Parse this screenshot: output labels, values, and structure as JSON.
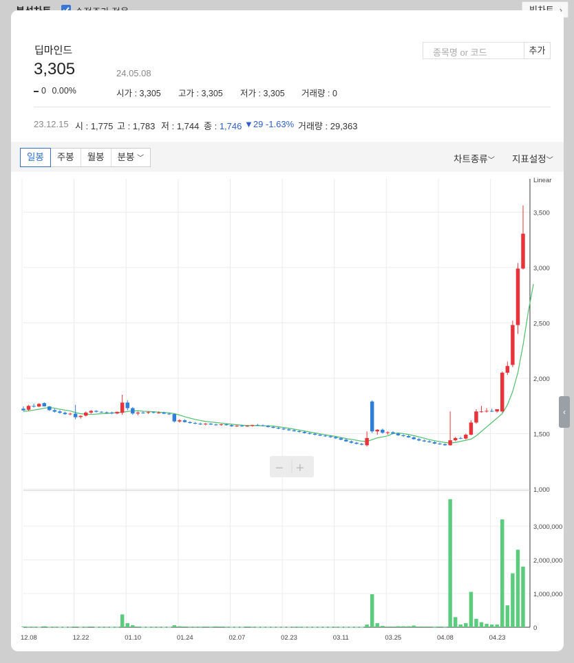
{
  "header": {
    "title": "분석차트",
    "adjusted_label": "수정주가 적용",
    "adjusted_checked": true,
    "big_chart": "빅차트"
  },
  "stock": {
    "name": "딥마인드",
    "price": "3,305",
    "date": "24.05.08",
    "change": "0",
    "change_pct": "0.00%",
    "open_label": "시가",
    "open": "3,305",
    "high_label": "고가",
    "high": "3,305",
    "low_label": "저가",
    "low": "3,305",
    "volume_label": "거래량",
    "volume": "0"
  },
  "search": {
    "placeholder": "종목명 or 코드",
    "add": "추가"
  },
  "hover": {
    "date": "23.12.15",
    "open_label": "시",
    "open": "1,775",
    "high_label": "고",
    "high": "1,783",
    "low_label": "저",
    "low": "1,744",
    "close_label": "종",
    "close": "1,746",
    "diff": "▼29",
    "diff_pct": "-1.63%",
    "volume_label": "거래량",
    "volume": "29,363"
  },
  "tabs": [
    {
      "label": "일봉",
      "active": true
    },
    {
      "label": "주봉"
    },
    {
      "label": "월봉"
    },
    {
      "label": "분봉"
    }
  ],
  "menus": {
    "chart_type": "차트종류",
    "indicator": "지표설정"
  },
  "zoom": {
    "minus": "−",
    "plus": "+"
  },
  "colors": {
    "up": "#e8333a",
    "down": "#2f7fd6",
    "volume": "#5bcc7e",
    "ma5": "#4fbf6c",
    "ma20": "#d04b3a",
    "ma60": "#e89a3c",
    "ma120": "#b66bd6"
  },
  "chart_data": {
    "type": "candlestick",
    "scale_label": "Linear",
    "price_ticks": [
      "3,500",
      "3,000",
      "2,500",
      "2,000",
      "1,500",
      "1,000"
    ],
    "price_tick_values": [
      3500,
      3000,
      2500,
      2000,
      1500,
      1000
    ],
    "ylim": [
      1000,
      3800
    ],
    "volume_ticks": [
      "3,000,000",
      "2,000,000",
      "1,000,000",
      "0"
    ],
    "volume_tick_values": [
      3000000,
      2000000,
      1000000,
      0
    ],
    "vlim": [
      0,
      4000000
    ],
    "x_tick_labels": [
      "12.08",
      "12.22",
      "01.10",
      "01.24",
      "02.07",
      "02.23",
      "03.11",
      "03.25",
      "04.08",
      "04.23"
    ],
    "x_tick_index": [
      0,
      10,
      20,
      30,
      40,
      50,
      60,
      70,
      80,
      90
    ],
    "candles": [
      {
        "o": 1725,
        "h": 1745,
        "l": 1705,
        "c": 1710,
        "v": 20000
      },
      {
        "o": 1715,
        "h": 1760,
        "l": 1705,
        "c": 1750,
        "v": 15000
      },
      {
        "o": 1750,
        "h": 1770,
        "l": 1735,
        "c": 1745,
        "v": 15000
      },
      {
        "o": 1745,
        "h": 1775,
        "l": 1738,
        "c": 1768,
        "v": 10000
      },
      {
        "o": 1775,
        "h": 1783,
        "l": 1744,
        "c": 1746,
        "v": 29363
      },
      {
        "o": 1745,
        "h": 1750,
        "l": 1705,
        "c": 1712,
        "v": 12000
      },
      {
        "o": 1712,
        "h": 1725,
        "l": 1690,
        "c": 1698,
        "v": 15000
      },
      {
        "o": 1700,
        "h": 1712,
        "l": 1680,
        "c": 1688,
        "v": 10000
      },
      {
        "o": 1688,
        "h": 1698,
        "l": 1670,
        "c": 1676,
        "v": 10000
      },
      {
        "o": 1676,
        "h": 1690,
        "l": 1665,
        "c": 1680,
        "v": 8000
      },
      {
        "o": 1680,
        "h": 1760,
        "l": 1630,
        "c": 1648,
        "v": 20000
      },
      {
        "o": 1650,
        "h": 1665,
        "l": 1635,
        "c": 1660,
        "v": 10000
      },
      {
        "o": 1662,
        "h": 1700,
        "l": 1655,
        "c": 1690,
        "v": 15000
      },
      {
        "o": 1690,
        "h": 1712,
        "l": 1680,
        "c": 1705,
        "v": 20000
      },
      {
        "o": 1705,
        "h": 1712,
        "l": 1690,
        "c": 1697,
        "v": 10000
      },
      {
        "o": 1697,
        "h": 1702,
        "l": 1688,
        "c": 1692,
        "v": 8000
      },
      {
        "o": 1692,
        "h": 1700,
        "l": 1682,
        "c": 1690,
        "v": 8000
      },
      {
        "o": 1690,
        "h": 1698,
        "l": 1675,
        "c": 1682,
        "v": 10000
      },
      {
        "o": 1682,
        "h": 1700,
        "l": 1675,
        "c": 1696,
        "v": 12000
      },
      {
        "o": 1688,
        "h": 1850,
        "l": 1670,
        "c": 1780,
        "v": 380000
      },
      {
        "o": 1780,
        "h": 1800,
        "l": 1710,
        "c": 1730,
        "v": 120000
      },
      {
        "o": 1730,
        "h": 1740,
        "l": 1670,
        "c": 1682,
        "v": 60000
      },
      {
        "o": 1682,
        "h": 1700,
        "l": 1665,
        "c": 1690,
        "v": 20000
      },
      {
        "o": 1690,
        "h": 1705,
        "l": 1680,
        "c": 1687,
        "v": 10000
      },
      {
        "o": 1687,
        "h": 1700,
        "l": 1678,
        "c": 1694,
        "v": 10000
      },
      {
        "o": 1694,
        "h": 1700,
        "l": 1682,
        "c": 1688,
        "v": 8000
      },
      {
        "o": 1688,
        "h": 1700,
        "l": 1680,
        "c": 1690,
        "v": 8000
      },
      {
        "o": 1690,
        "h": 1698,
        "l": 1675,
        "c": 1680,
        "v": 10000
      },
      {
        "o": 1680,
        "h": 1690,
        "l": 1668,
        "c": 1676,
        "v": 10000
      },
      {
        "o": 1676,
        "h": 1682,
        "l": 1600,
        "c": 1610,
        "v": 60000
      },
      {
        "o": 1610,
        "h": 1630,
        "l": 1598,
        "c": 1620,
        "v": 30000
      },
      {
        "o": 1620,
        "h": 1630,
        "l": 1600,
        "c": 1604,
        "v": 20000
      },
      {
        "o": 1604,
        "h": 1612,
        "l": 1590,
        "c": 1596,
        "v": 15000
      },
      {
        "o": 1596,
        "h": 1605,
        "l": 1585,
        "c": 1590,
        "v": 15000
      },
      {
        "o": 1590,
        "h": 1600,
        "l": 1578,
        "c": 1585,
        "v": 15000
      },
      {
        "o": 1585,
        "h": 1595,
        "l": 1575,
        "c": 1590,
        "v": 20000
      },
      {
        "o": 1590,
        "h": 1595,
        "l": 1578,
        "c": 1582,
        "v": 15000
      },
      {
        "o": 1582,
        "h": 1590,
        "l": 1572,
        "c": 1578,
        "v": 25000
      },
      {
        "o": 1578,
        "h": 1588,
        "l": 1570,
        "c": 1584,
        "v": 20000
      },
      {
        "o": 1584,
        "h": 1590,
        "l": 1572,
        "c": 1576,
        "v": 15000
      },
      {
        "o": 1576,
        "h": 1582,
        "l": 1562,
        "c": 1566,
        "v": 10000
      },
      {
        "o": 1566,
        "h": 1576,
        "l": 1560,
        "c": 1572,
        "v": 10000
      },
      {
        "o": 1572,
        "h": 1580,
        "l": 1562,
        "c": 1568,
        "v": 10000
      },
      {
        "o": 1568,
        "h": 1575,
        "l": 1560,
        "c": 1570,
        "v": 20000
      },
      {
        "o": 1570,
        "h": 1580,
        "l": 1562,
        "c": 1578,
        "v": 15000
      },
      {
        "o": 1578,
        "h": 1588,
        "l": 1568,
        "c": 1574,
        "v": 10000
      },
      {
        "o": 1574,
        "h": 1582,
        "l": 1565,
        "c": 1570,
        "v": 10000
      },
      {
        "o": 1570,
        "h": 1576,
        "l": 1555,
        "c": 1560,
        "v": 10000
      },
      {
        "o": 1560,
        "h": 1568,
        "l": 1548,
        "c": 1552,
        "v": 10000
      },
      {
        "o": 1552,
        "h": 1560,
        "l": 1540,
        "c": 1545,
        "v": 10000
      },
      {
        "o": 1545,
        "h": 1552,
        "l": 1532,
        "c": 1538,
        "v": 10000
      },
      {
        "o": 1538,
        "h": 1545,
        "l": 1525,
        "c": 1530,
        "v": 10000
      },
      {
        "o": 1530,
        "h": 1538,
        "l": 1518,
        "c": 1522,
        "v": 15000
      },
      {
        "o": 1522,
        "h": 1530,
        "l": 1510,
        "c": 1515,
        "v": 15000
      },
      {
        "o": 1515,
        "h": 1522,
        "l": 1500,
        "c": 1505,
        "v": 10000
      },
      {
        "o": 1505,
        "h": 1512,
        "l": 1492,
        "c": 1498,
        "v": 10000
      },
      {
        "o": 1498,
        "h": 1506,
        "l": 1485,
        "c": 1490,
        "v": 10000
      },
      {
        "o": 1490,
        "h": 1498,
        "l": 1478,
        "c": 1482,
        "v": 10000
      },
      {
        "o": 1482,
        "h": 1490,
        "l": 1470,
        "c": 1476,
        "v": 10000
      },
      {
        "o": 1476,
        "h": 1484,
        "l": 1462,
        "c": 1468,
        "v": 10000
      },
      {
        "o": 1468,
        "h": 1476,
        "l": 1452,
        "c": 1458,
        "v": 15000
      },
      {
        "o": 1458,
        "h": 1468,
        "l": 1440,
        "c": 1445,
        "v": 10000
      },
      {
        "o": 1445,
        "h": 1455,
        "l": 1425,
        "c": 1430,
        "v": 10000
      },
      {
        "o": 1430,
        "h": 1438,
        "l": 1412,
        "c": 1418,
        "v": 10000
      },
      {
        "o": 1418,
        "h": 1425,
        "l": 1402,
        "c": 1408,
        "v": 10000
      },
      {
        "o": 1408,
        "h": 1415,
        "l": 1395,
        "c": 1400,
        "v": 10000
      },
      {
        "o": 1395,
        "h": 1520,
        "l": 1385,
        "c": 1460,
        "v": 80000
      },
      {
        "o": 1790,
        "h": 1800,
        "l": 1505,
        "c": 1520,
        "v": 980000
      },
      {
        "o": 1520,
        "h": 1540,
        "l": 1490,
        "c": 1535,
        "v": 120000
      },
      {
        "o": 1535,
        "h": 1545,
        "l": 1500,
        "c": 1508,
        "v": 40000
      },
      {
        "o": 1508,
        "h": 1520,
        "l": 1490,
        "c": 1512,
        "v": 20000
      },
      {
        "o": 1512,
        "h": 1522,
        "l": 1495,
        "c": 1500,
        "v": 20000
      },
      {
        "o": 1500,
        "h": 1508,
        "l": 1480,
        "c": 1485,
        "v": 30000
      },
      {
        "o": 1485,
        "h": 1495,
        "l": 1470,
        "c": 1478,
        "v": 30000
      },
      {
        "o": 1478,
        "h": 1488,
        "l": 1462,
        "c": 1466,
        "v": 30000
      },
      {
        "o": 1466,
        "h": 1475,
        "l": 1445,
        "c": 1450,
        "v": 50000
      },
      {
        "o": 1450,
        "h": 1460,
        "l": 1432,
        "c": 1438,
        "v": 20000
      },
      {
        "o": 1438,
        "h": 1448,
        "l": 1425,
        "c": 1430,
        "v": 20000
      },
      {
        "o": 1430,
        "h": 1440,
        "l": 1418,
        "c": 1422,
        "v": 20000
      },
      {
        "o": 1422,
        "h": 1430,
        "l": 1405,
        "c": 1410,
        "v": 15000
      },
      {
        "o": 1410,
        "h": 1420,
        "l": 1398,
        "c": 1405,
        "v": 20000
      },
      {
        "o": 1405,
        "h": 1412,
        "l": 1390,
        "c": 1395,
        "v": 15000
      },
      {
        "o": 1395,
        "h": 1700,
        "l": 1390,
        "c": 1440,
        "v": 3800000
      },
      {
        "o": 1440,
        "h": 1470,
        "l": 1430,
        "c": 1460,
        "v": 300000
      },
      {
        "o": 1460,
        "h": 1470,
        "l": 1450,
        "c": 1455,
        "v": 80000
      },
      {
        "o": 1455,
        "h": 1500,
        "l": 1448,
        "c": 1490,
        "v": 120000
      },
      {
        "o": 1490,
        "h": 1620,
        "l": 1485,
        "c": 1600,
        "v": 1050000
      },
      {
        "o": 1600,
        "h": 1720,
        "l": 1590,
        "c": 1700,
        "v": 250000
      },
      {
        "o": 1700,
        "h": 1750,
        "l": 1690,
        "c": 1700,
        "v": 150000
      },
      {
        "o": 1700,
        "h": 1730,
        "l": 1690,
        "c": 1705,
        "v": 100000
      },
      {
        "o": 1705,
        "h": 1725,
        "l": 1695,
        "c": 1700,
        "v": 80000
      },
      {
        "o": 1700,
        "h": 1720,
        "l": 1690,
        "c": 1720,
        "v": 80000
      },
      {
        "o": 1700,
        "h": 2060,
        "l": 1690,
        "c": 2050,
        "v": 3200000
      },
      {
        "o": 2050,
        "h": 2150,
        "l": 2030,
        "c": 2110,
        "v": 650000
      },
      {
        "o": 2120,
        "h": 2520,
        "l": 2100,
        "c": 2480,
        "v": 1600000
      },
      {
        "o": 2480,
        "h": 3040,
        "l": 2400,
        "c": 2990,
        "v": 2300000
      },
      {
        "o": 2990,
        "h": 3560,
        "l": 2980,
        "c": 3305,
        "v": 1800000
      }
    ],
    "ma_series": [
      {
        "key": "ma5",
        "values": [
          1700,
          1705,
          1712,
          1720,
          1730,
          1735,
          1730,
          1720,
          1712,
          1705,
          1690,
          1680,
          1675,
          1674,
          1676,
          1680,
          1682,
          1686,
          1690,
          1692,
          1700,
          1705,
          1706,
          1702,
          1700,
          1698,
          1694,
          1690,
          1688,
          1680,
          1668,
          1652,
          1640,
          1628,
          1618,
          1610,
          1605,
          1600,
          1595,
          1590,
          1585,
          1580,
          1576,
          1574,
          1572,
          1572,
          1571,
          1570,
          1568,
          1562,
          1555,
          1548,
          1540,
          1532,
          1524,
          1515,
          1506,
          1498,
          1490,
          1482,
          1474,
          1465,
          1456,
          1448,
          1440,
          1432,
          1430,
          1445,
          1462,
          1470,
          1480,
          1500,
          1505,
          1500,
          1492,
          1482,
          1470,
          1458,
          1446,
          1436,
          1428,
          1420,
          1415,
          1420,
          1430,
          1440,
          1450,
          1480,
          1520,
          1560,
          1600,
          1640,
          1680,
          1760,
          1880,
          2050,
          2300,
          2600,
          2850
        ]
      }
    ]
  }
}
